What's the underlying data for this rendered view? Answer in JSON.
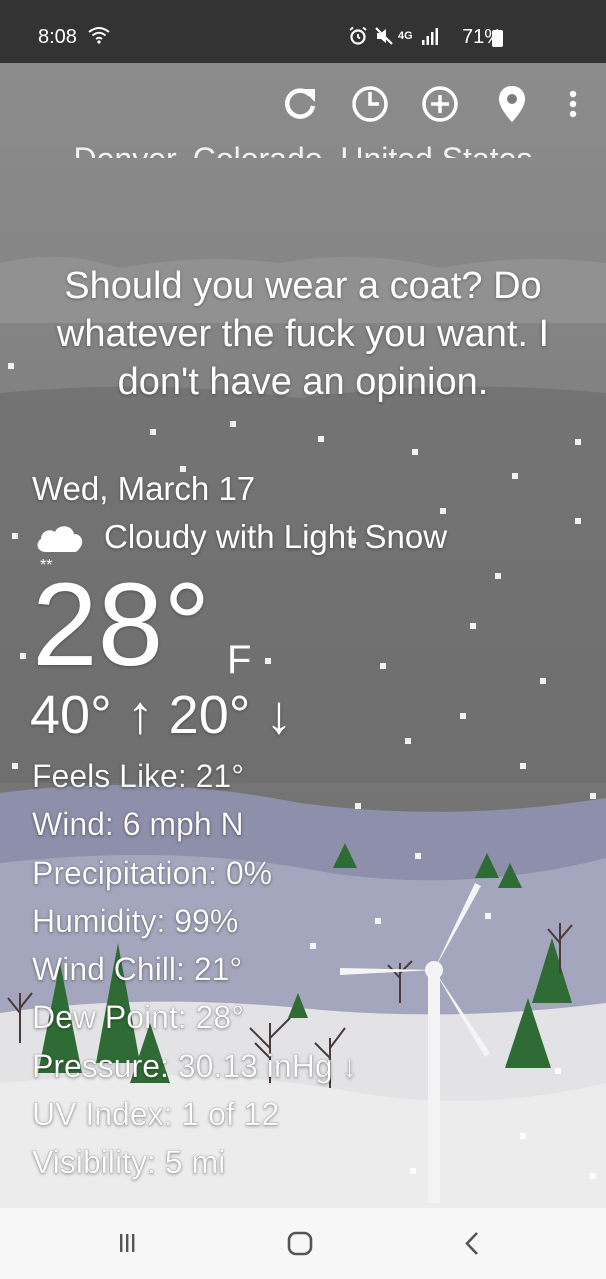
{
  "status_bar": {
    "time": "8:08",
    "battery": "71%",
    "network": "4G"
  },
  "toolbar": {
    "icons": [
      "refresh-icon",
      "history-icon",
      "add-icon",
      "location-pin-icon",
      "more-vert-icon"
    ]
  },
  "location": "Denver, Colorado, United States",
  "snark": "Should you wear a coat? Do whatever the fuck you want. I don't have an opinion.",
  "weather": {
    "date": "Wed, March 17",
    "condition": "Cloudy with Light Snow",
    "condition_icon": "cloud-snow-icon",
    "temperature": "28°",
    "unit": "F",
    "high_low": "40° ↑ 20° ↓"
  },
  "details": [
    "Feels Like: 21°",
    "Wind: 6 mph N",
    "Precipitation: 0%",
    "Humidity: 99%",
    "Wind Chill: 21°",
    "Dew Point: 28°",
    "Pressure: 30.13 inHg ↓",
    "UV Index: 1 of 12",
    "Visibility: 5 mi"
  ],
  "nav": {
    "icons": [
      "recents-icon",
      "home-icon",
      "back-icon"
    ]
  },
  "colors": {
    "sky": "#6f6f6f",
    "status_bar": "#333333",
    "nav_bar": "#f7f7f7",
    "tree": "#2f6b35",
    "snow": "#e9e9e9"
  }
}
